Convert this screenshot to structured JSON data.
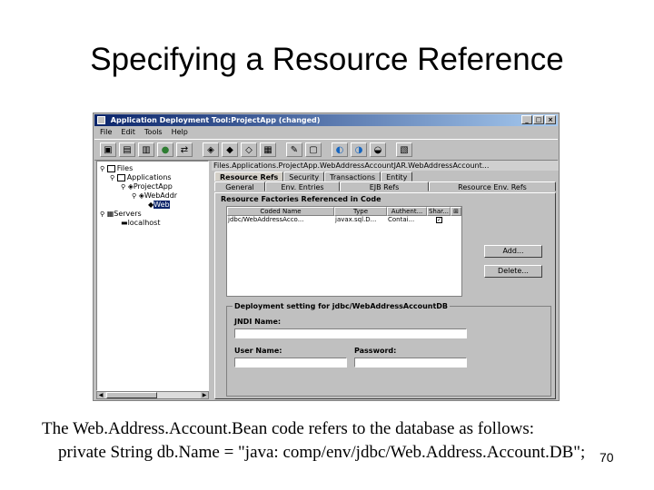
{
  "slide": {
    "title": "Specifying a Resource Reference",
    "caption_line1": "The Web.Address.Account.Bean code refers to the database as follows:",
    "caption_line2": "private String db.Name = \"java: comp/env/jdbc/Web.Address.Account.DB\";",
    "page_number": "70"
  },
  "window": {
    "title": "Application Deployment Tool:ProjectApp (changed)",
    "controls": [
      "_",
      "□",
      "×"
    ],
    "menu": [
      "File",
      "Edit",
      "Tools",
      "Help"
    ],
    "toolbar_icons": [
      "new-app-icon",
      "open-icon",
      "save-icon",
      "globe-icon",
      "deploy-icon",
      "new-ejb-icon",
      "new-web-icon",
      "new-client-icon",
      "server-icon",
      "verify-icon",
      "inspect-icon",
      "configure-icon",
      "recent-icon",
      "tools-icon",
      "help-icon"
    ]
  },
  "tree": {
    "items": [
      {
        "label": "Files",
        "indent": 0
      },
      {
        "label": "Applications",
        "indent": 1
      },
      {
        "label": "ProjectApp",
        "indent": 2
      },
      {
        "label": "WebAddr",
        "indent": 3
      },
      {
        "label": "Web",
        "indent": 4,
        "selected": true
      },
      {
        "label": "Servers",
        "indent": 0
      },
      {
        "label": "localhost",
        "indent": 1
      }
    ]
  },
  "right_panel": {
    "path": "Files.Applications.ProjectApp.WebAddressAccountJAR.WebAddressAccount...",
    "tabs_row1": [
      "Resource Refs",
      "Security",
      "Transactions",
      "Entity"
    ],
    "tabs_row2": [
      "General",
      "Env. Entries",
      "EJB Refs",
      "Resource Env. Refs"
    ],
    "section_label": "Resource Factories Referenced in Code",
    "table": {
      "headers": [
        "Coded Name",
        "Type",
        "Authent...",
        "Shar..."
      ],
      "rows": [
        {
          "coded_name": "jdbc/WebAddressAcco...",
          "type": "javax.sql.D...",
          "authent": "Contai...",
          "shar_checked": true
        }
      ]
    },
    "buttons": {
      "add": "Add...",
      "delete": "Delete..."
    },
    "deployment": {
      "group_title": "Deployment setting for jdbc/WebAddressAccountDB",
      "jndi_label": "JNDI Name:",
      "user_label": "User Name:",
      "password_label": "Password:",
      "jndi_value": "",
      "user_value": "",
      "password_value": ""
    }
  },
  "colors": {
    "titlebar_start": "#0a246a",
    "titlebar_end": "#a6caf0",
    "window_bg": "#c0c0c0",
    "selection": "#0a246a"
  }
}
